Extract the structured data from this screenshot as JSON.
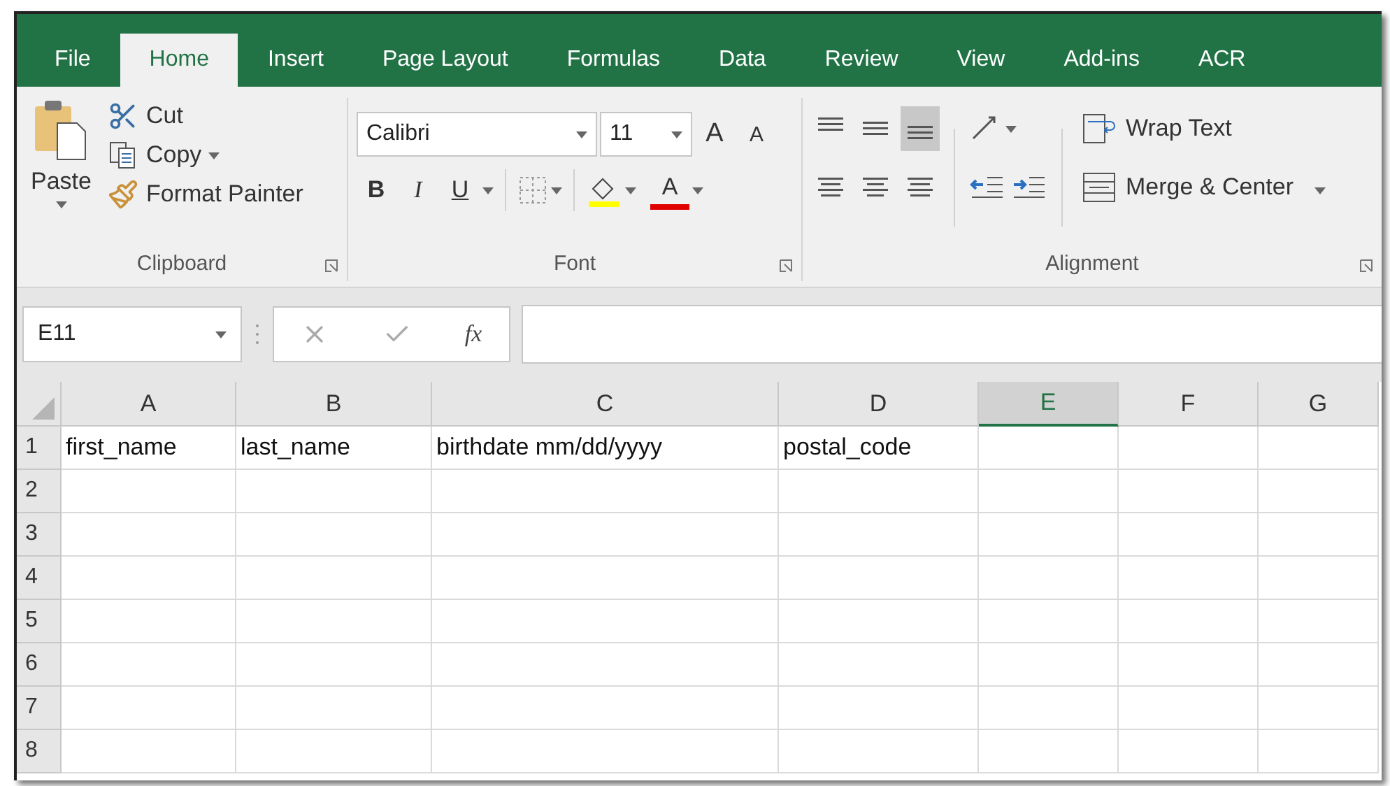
{
  "tabs": [
    {
      "label": "File",
      "selected": false
    },
    {
      "label": "Home",
      "selected": true
    },
    {
      "label": "Insert",
      "selected": false
    },
    {
      "label": "Page Layout",
      "selected": false
    },
    {
      "label": "Formulas",
      "selected": false
    },
    {
      "label": "Data",
      "selected": false
    },
    {
      "label": "Review",
      "selected": false
    },
    {
      "label": "View",
      "selected": false
    },
    {
      "label": "Add-ins",
      "selected": false
    },
    {
      "label": "ACR",
      "selected": false
    }
  ],
  "clipboard": {
    "paste": "Paste",
    "cut": "Cut",
    "copy": "Copy",
    "format_painter": "Format Painter",
    "group_label": "Clipboard"
  },
  "font": {
    "font_name": "Calibri",
    "font_size": "11",
    "grow": "A",
    "shrink": "A",
    "bold": "B",
    "italic": "I",
    "underline": "U",
    "font_color": "A",
    "group_label": "Font"
  },
  "alignment": {
    "vertical": [
      {
        "kind": "top",
        "selected": false
      },
      {
        "kind": "middle",
        "selected": false
      },
      {
        "kind": "bottom",
        "selected": true
      }
    ],
    "wrap_text": "Wrap Text",
    "merge_center": "Merge & Center",
    "group_label": "Alignment"
  },
  "formula_bar": {
    "name_box": "E11",
    "function_label": "fx"
  },
  "columns": [
    {
      "label": "A",
      "selected": false
    },
    {
      "label": "B",
      "selected": false
    },
    {
      "label": "C",
      "selected": false
    },
    {
      "label": "D",
      "selected": false
    },
    {
      "label": "E",
      "selected": true
    },
    {
      "label": "F",
      "selected": false
    },
    {
      "label": "G",
      "selected": false
    }
  ],
  "rows": [
    {
      "number": "1",
      "cells": [
        "first_name",
        "last_name",
        "birthdate mm/dd/yyyy",
        "postal_code"
      ]
    },
    {
      "number": "2"
    },
    {
      "number": "3"
    },
    {
      "number": "4"
    },
    {
      "number": "5"
    },
    {
      "number": "6"
    },
    {
      "number": "7"
    },
    {
      "number": "8"
    }
  ]
}
